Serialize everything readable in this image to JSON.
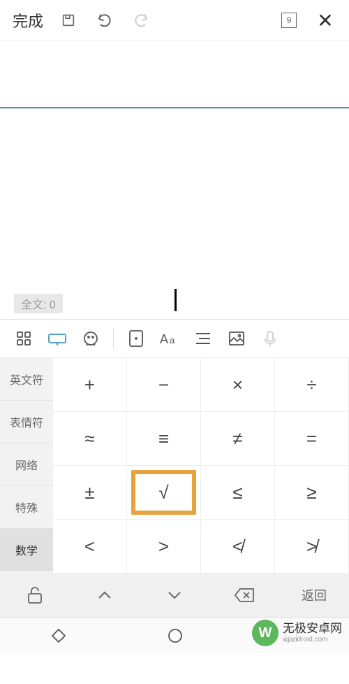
{
  "topbar": {
    "done_label": "完成",
    "page_number": "9"
  },
  "editor": {
    "word_count": "全文: 0"
  },
  "symbol_tabs": [
    "英文符",
    "表情符",
    "网络",
    "特殊",
    "数学"
  ],
  "active_tab_index": 4,
  "symbols": [
    "+",
    "−",
    "×",
    "÷",
    "≈",
    "≡",
    "≠",
    "=",
    "±",
    "√",
    "≤",
    "≥",
    "<",
    ">",
    "≮",
    "≯"
  ],
  "highlighted_index": 9,
  "kbd_bottom": {
    "back_label": "返回"
  },
  "watermark": {
    "title": "无极安卓网",
    "subtitle": "wjandroid.com",
    "logo": "W"
  }
}
